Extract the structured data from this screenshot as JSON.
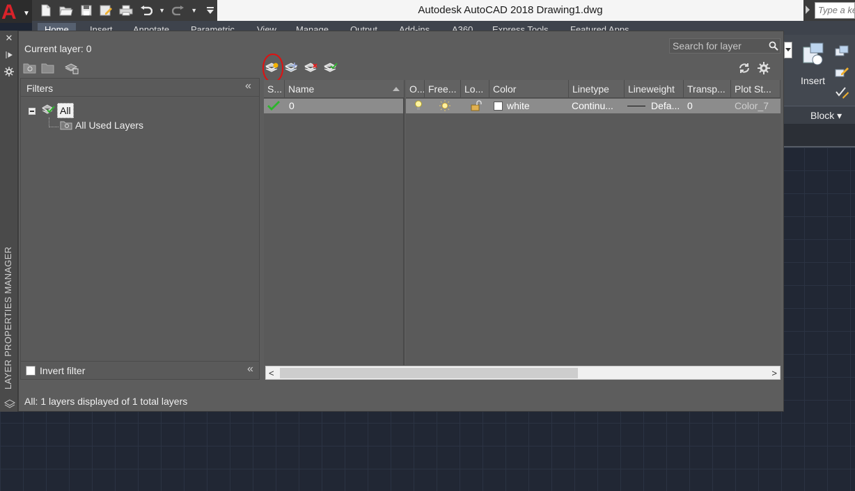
{
  "window": {
    "title": "Autodesk AutoCAD 2018    Drawing1.dwg",
    "app_letter": "A",
    "keyword_search_placeholder": "Type a ke"
  },
  "quick_access": [
    {
      "icon": "new-icon"
    },
    {
      "icon": "open-icon"
    },
    {
      "icon": "save-icon"
    },
    {
      "icon": "save-as-icon"
    },
    {
      "icon": "plot-icon"
    },
    {
      "icon": "undo-icon"
    },
    {
      "icon": "redo-icon"
    },
    {
      "icon": "customize-qat-icon"
    }
  ],
  "ribbon": {
    "tabs": [
      "Home",
      "Insert",
      "Annotate",
      "Parametric",
      "View",
      "Manage",
      "Output",
      "Add-ins",
      "A360",
      "Express Tools",
      "Featured Apps"
    ],
    "insert_label": "Insert",
    "block_panel_label": "Block ▾"
  },
  "palette": {
    "strip_title": "LAYER PROPERTIES MANAGER",
    "current_layer": "Current layer: 0",
    "search_placeholder": "Search for layer",
    "filters_label": "Filters",
    "collapse_glyph": "«",
    "tree": {
      "root": "All",
      "child": "All Used Layers"
    },
    "invert_filter_label": "Invert filter",
    "status": "All: 1 layers displayed of 1 total layers",
    "toolbar_icons": [
      "new-layer-icon",
      "new-layer-vp-frozen-icon",
      "delete-layer-icon",
      "set-current-icon"
    ],
    "highlight_color": "#e01010"
  },
  "layer_grid": {
    "columns_left": [
      "S...",
      "Name"
    ],
    "columns_right": [
      "O...",
      "Free...",
      "Lo...",
      "Color",
      "Linetype",
      "Lineweight",
      "Transp...",
      "Plot St..."
    ],
    "rows": [
      {
        "status": "current",
        "name": "0",
        "on": "on",
        "freeze": "thawed",
        "lock": "unlocked",
        "color": "white",
        "linetype": "Continu...",
        "lineweight": "Defa...",
        "transparency": "0",
        "plot_style": "Color_7"
      }
    ]
  },
  "scrollbar": {
    "left_glyph": "<",
    "right_glyph": ">"
  }
}
